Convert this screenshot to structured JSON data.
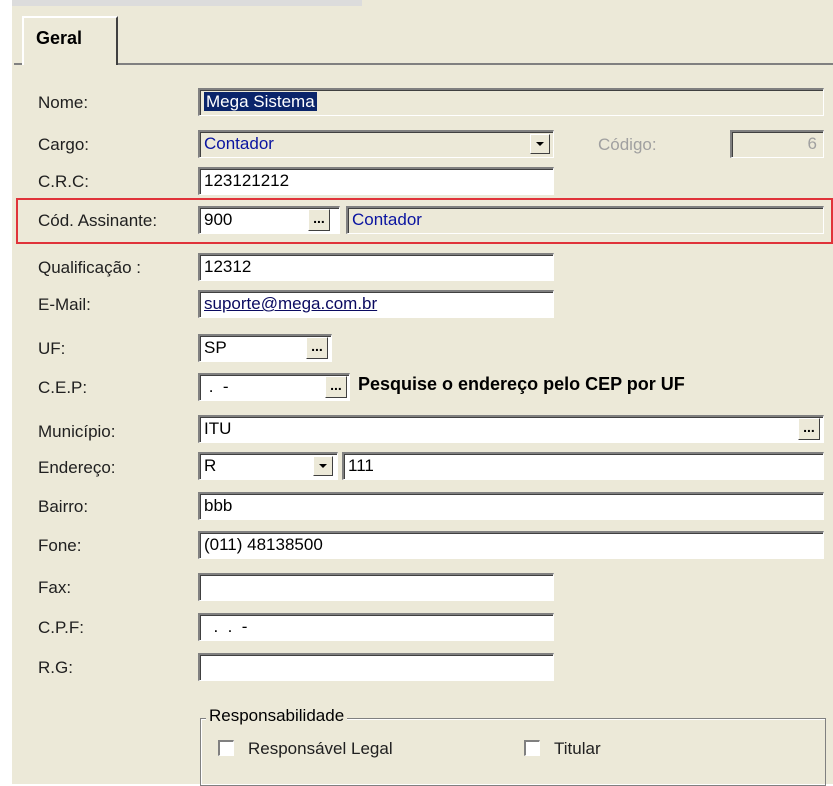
{
  "tab": {
    "label": "Geral"
  },
  "form": {
    "nome": {
      "label": "Nome:",
      "value": "Mega Sistema"
    },
    "cargo": {
      "label": "Cargo:",
      "value": "Contador"
    },
    "codigo": {
      "label": "Código:",
      "value": "6"
    },
    "crc": {
      "label": "C.R.C:",
      "value": "123121212"
    },
    "cod_assinante": {
      "label": "Cód. Assinante:",
      "value": "900",
      "desc": "Contador"
    },
    "qualificacao": {
      "label": "Qualificação :",
      "value": "12312"
    },
    "email": {
      "label": "E-Mail:",
      "value": "suporte@mega.com.br"
    },
    "uf": {
      "label": "UF:",
      "value": "SP"
    },
    "cep": {
      "label": "C.E.P:",
      "value": " .  -",
      "hint": "Pesquise o endereço pelo CEP por UF"
    },
    "municipio": {
      "label": "Município:",
      "value": "ITU"
    },
    "endereco": {
      "label": "Endereço:",
      "type_value": "R",
      "value": "111"
    },
    "bairro": {
      "label": "Bairro:",
      "value": "bbb"
    },
    "fone": {
      "label": "Fone:",
      "value": "(011) 48138500"
    },
    "fax": {
      "label": "Fax:",
      "value": ""
    },
    "cpf": {
      "label": "C.P.F:",
      "value": "  .  .  -"
    },
    "rg": {
      "label": "R.G:",
      "value": ""
    }
  },
  "responsabilidade": {
    "legend": "Responsabilidade",
    "legal": "Responsável Legal",
    "titular": "Titular"
  },
  "icons": {
    "ellipsis": "...",
    "dropdown": "chevron-down-icon"
  },
  "colors": {
    "highlight_border": "#e0333a",
    "selection": "#0a246a",
    "link_text": "#0a14a0"
  }
}
